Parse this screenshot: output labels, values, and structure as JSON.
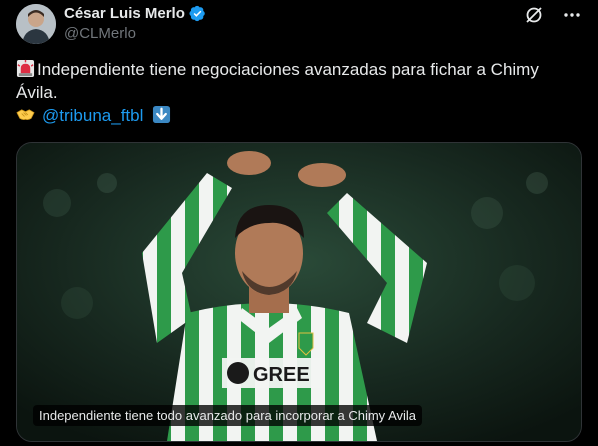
{
  "author": {
    "name": "César Luis Merlo",
    "handle": "@CLMerlo",
    "verified": true
  },
  "icons": [
    "grok-icon",
    "more-icon",
    "verified-badge-icon",
    "siren-emoji",
    "handshake-emoji",
    "down-arrow-emoji"
  ],
  "tweet": {
    "text": "Independiente tiene negociaciones avanzadas para fichar a Chimy Ávila.",
    "mention": "@tribuna_ftbl"
  },
  "media": {
    "caption": "Independiente tiene todo avanzado para incorporar a Chimy Avila",
    "shirt_sponsor": "GREE"
  },
  "colors": {
    "background": "#000000",
    "text": "#e7e9ea",
    "secondary": "#71767b",
    "link": "#1d9bf0",
    "jersey_green": "#2e9a4a"
  }
}
